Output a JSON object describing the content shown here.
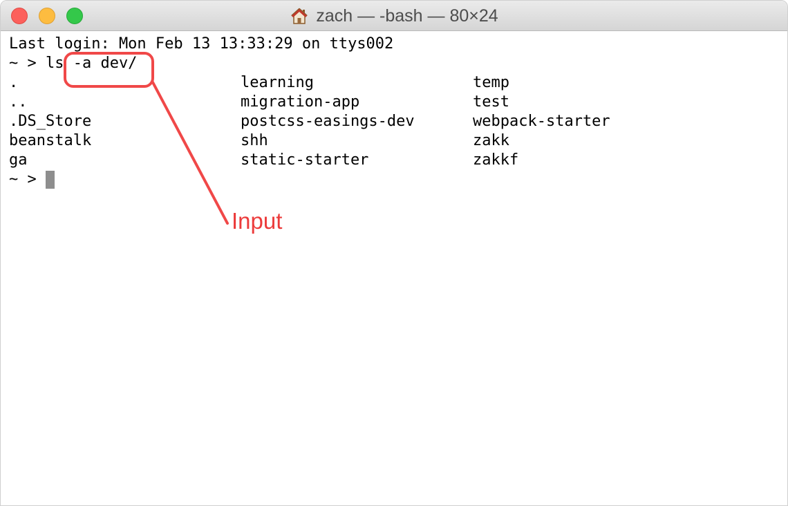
{
  "window": {
    "title": "zach — -bash — 80×24",
    "title_icon": "home-icon"
  },
  "colors": {
    "close": "#fc605c",
    "minimize": "#fdbc40",
    "maximize": "#34c84a",
    "annotation": "#f04848",
    "cursor": "#8e8e8e"
  },
  "terminal": {
    "last_login": "Last login: Mon Feb 13 13:33:29 on ttys002",
    "prompt_command": "~ > ls -a dev/",
    "listing": [
      [
        ".",
        "learning",
        "temp"
      ],
      [
        "..",
        "migration-app",
        "test"
      ],
      [
        ".DS_Store",
        "postcss-easings-dev",
        "webpack-starter"
      ],
      [
        "beanstalk",
        "shh",
        "zakk"
      ],
      [
        "ga",
        "static-starter",
        "zakkf"
      ]
    ],
    "current_prompt": "~ > "
  },
  "annotation": {
    "label": "Input"
  }
}
